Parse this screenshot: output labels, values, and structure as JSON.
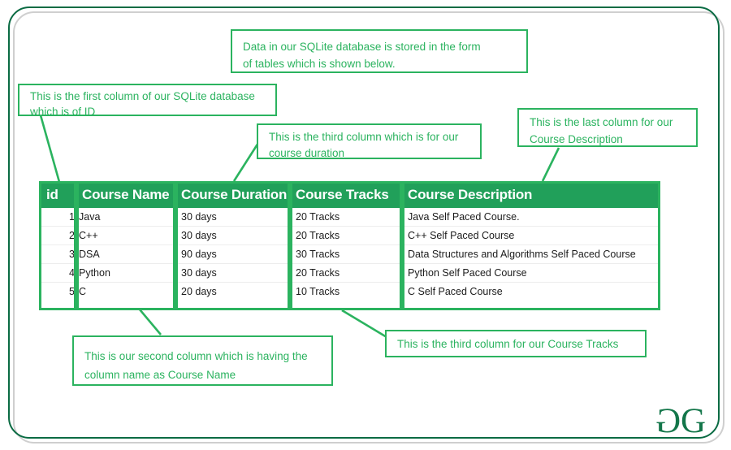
{
  "theme": {
    "frame_border_color": "#0a6b43",
    "frame_shadow_color": "#cfcfcf",
    "accent_green": "#2bb35f",
    "header_green": "#21a05a",
    "logo_green": "#13764a",
    "text_dark": "#1c1c1c"
  },
  "callouts": {
    "top_intro": {
      "line1": "Data in our SQLite database is stored in the form",
      "line2": "of tables which is shown below."
    },
    "first_column": {
      "line1": "This is the first column of our SQLite database",
      "line2": "which is of ID"
    },
    "third_column_duration": {
      "line1": "This is the third column which is for our",
      "line2": "course duration"
    },
    "last_column": {
      "line1": "This is the last column for our",
      "line2": "Course Description"
    },
    "second_column": {
      "line1": "This is our second column which is having the",
      "line2": "column name as Course Name"
    },
    "tracks_column": {
      "line1": "This is the third column for our Course Tracks"
    }
  },
  "table": {
    "columns": [
      "id",
      "Course Name",
      "Course Duration",
      "Course Tracks",
      "Course Description"
    ],
    "rows": [
      {
        "id": "1",
        "name": "Java",
        "duration": "30 days",
        "tracks": "20 Tracks",
        "description": "Java Self Paced Course."
      },
      {
        "id": "2",
        "name": "C++",
        "duration": "30 days",
        "tracks": "20 Tracks",
        "description": "C++ Self Paced Course"
      },
      {
        "id": "3",
        "name": "DSA",
        "duration": "90 days",
        "tracks": "30 Tracks",
        "description": "Data Structures and Algorithms Self Paced Course"
      },
      {
        "id": "4",
        "name": "Python",
        "duration": "30 days",
        "tracks": "20 Tracks",
        "description": "Python Self Paced Course"
      },
      {
        "id": "5",
        "name": "C",
        "duration": "20 days",
        "tracks": "10 Tracks",
        "description": "C Self Paced Course"
      }
    ]
  },
  "logo": {
    "left_glyph": "G",
    "right_glyph": "G",
    "name": "geeksforgeeks-logo"
  }
}
